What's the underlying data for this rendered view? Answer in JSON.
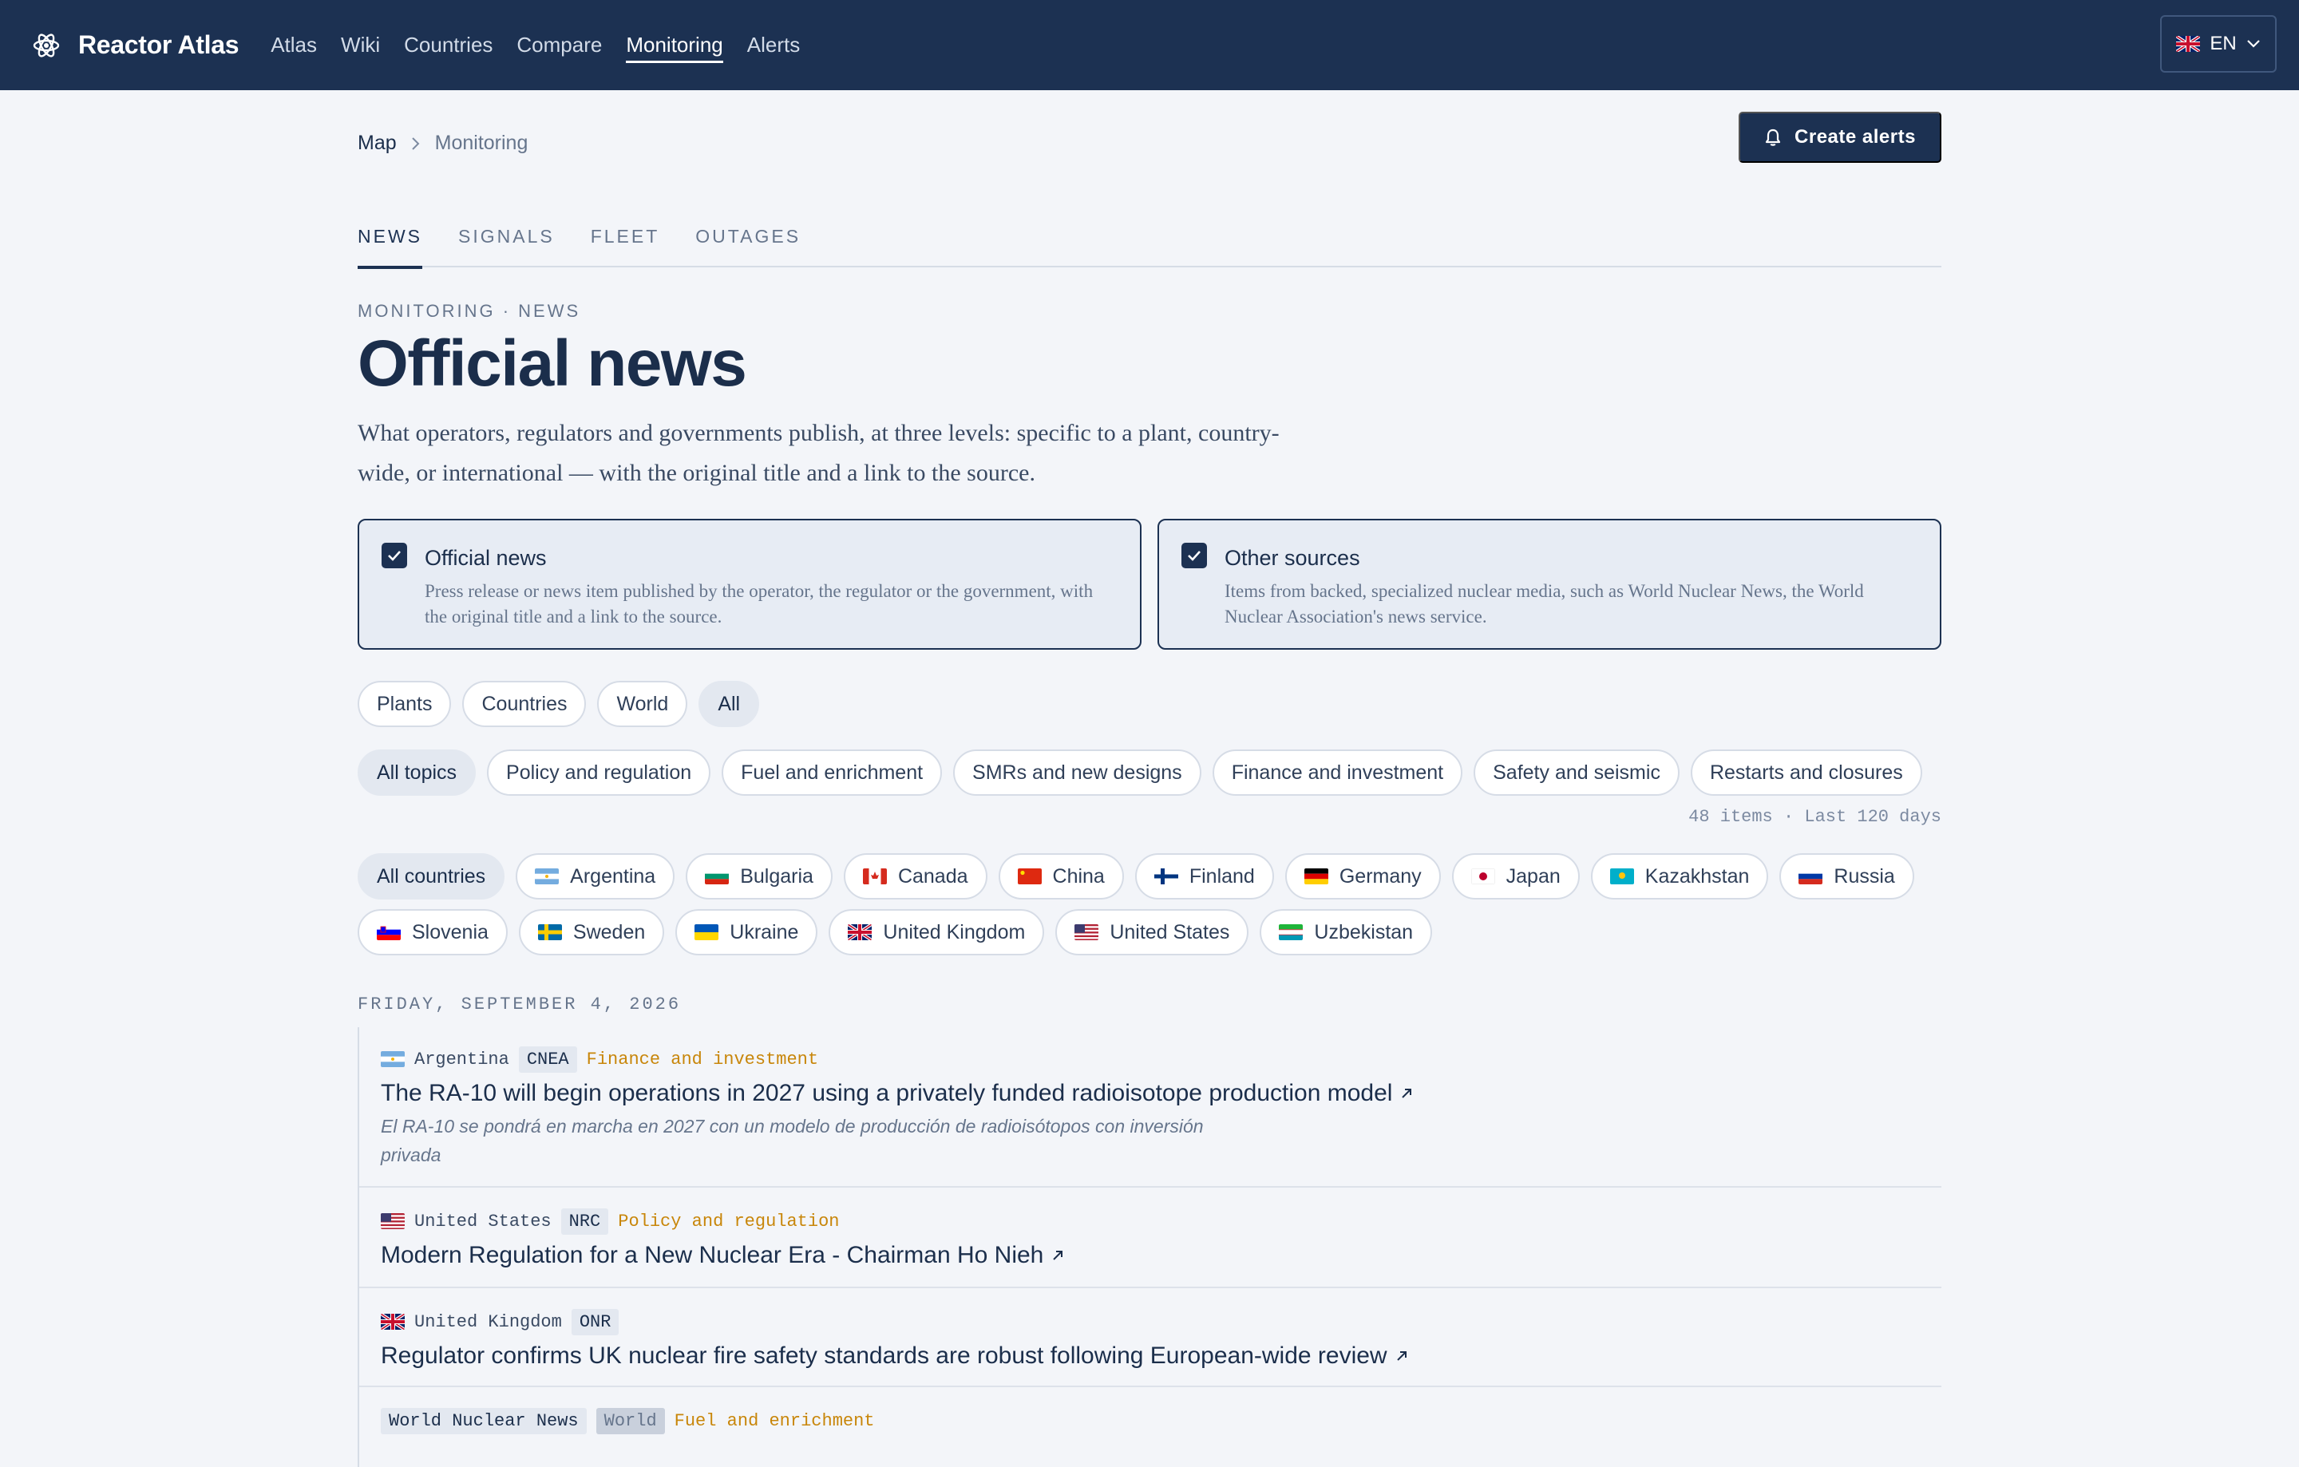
{
  "header": {
    "brand": "Reactor Atlas",
    "nav": [
      {
        "label": "Atlas",
        "active": false
      },
      {
        "label": "Wiki",
        "active": false
      },
      {
        "label": "Countries",
        "active": false
      },
      {
        "label": "Compare",
        "active": false
      },
      {
        "label": "Monitoring",
        "active": true
      },
      {
        "label": "Alerts",
        "active": false
      }
    ],
    "language": "EN",
    "language_icon": "uk-flag-icon"
  },
  "breadcrumb": {
    "root": "Map",
    "current": "Monitoring"
  },
  "create_alerts_label": "Create alerts",
  "tabs": [
    {
      "label": "NEWS",
      "active": true
    },
    {
      "label": "SIGNALS",
      "active": false
    },
    {
      "label": "FLEET",
      "active": false
    },
    {
      "label": "OUTAGES",
      "active": false
    }
  ],
  "eyebrow": "MONITORING · NEWS",
  "title": "Official news",
  "description": "What operators, regulators and governments publish, at three levels: specific to a plant, country-wide, or international — with the original title and a link to the source.",
  "sources": [
    {
      "title": "Official news",
      "checked": true,
      "description": "Press release or news item published by the operator, the regulator or the government, with the original title and a link to the source."
    },
    {
      "title": "Other sources",
      "checked": true,
      "description": "Items from backed, specialized nuclear media, such as World Nuclear News, the World Nuclear Association's news service."
    }
  ],
  "levels": [
    {
      "label": "Plants",
      "selected": false
    },
    {
      "label": "Countries",
      "selected": false
    },
    {
      "label": "World",
      "selected": false
    },
    {
      "label": "All",
      "selected": true
    }
  ],
  "topics": [
    {
      "label": "All topics",
      "selected": true
    },
    {
      "label": "Policy and regulation",
      "selected": false
    },
    {
      "label": "Fuel and enrichment",
      "selected": false
    },
    {
      "label": "SMRs and new designs",
      "selected": false
    },
    {
      "label": "Finance and investment",
      "selected": false
    },
    {
      "label": "Safety and seismic",
      "selected": false
    },
    {
      "label": "Restarts and closures",
      "selected": false
    }
  ],
  "items_meta": "48 items · Last 120 days",
  "countries": [
    {
      "label": "All countries",
      "selected": true,
      "flag": ""
    },
    {
      "label": "Argentina",
      "flag": "ar"
    },
    {
      "label": "Bulgaria",
      "flag": "bg"
    },
    {
      "label": "Canada",
      "flag": "ca"
    },
    {
      "label": "China",
      "flag": "cn"
    },
    {
      "label": "Finland",
      "flag": "fi"
    },
    {
      "label": "Germany",
      "flag": "de"
    },
    {
      "label": "Japan",
      "flag": "jp"
    },
    {
      "label": "Kazakhstan",
      "flag": "kz"
    },
    {
      "label": "Russia",
      "flag": "ru"
    },
    {
      "label": "Slovenia",
      "flag": "si"
    },
    {
      "label": "Sweden",
      "flag": "se"
    },
    {
      "label": "Ukraine",
      "flag": "ua"
    },
    {
      "label": "United Kingdom",
      "flag": "gb"
    },
    {
      "label": "United States",
      "flag": "us"
    },
    {
      "label": "Uzbekistan",
      "flag": "uz"
    }
  ],
  "date_heading": "FRIDAY, SEPTEMBER 4, 2026",
  "news": [
    {
      "country": "Argentina",
      "flag": "ar",
      "org": "CNEA",
      "topic": "Finance and investment",
      "title": "The RA-10 will begin operations in 2027 using a privately funded radioisotope production model",
      "original": "El RA-10 se pondrá en marcha en 2027 con un modelo de producción de radioisótopos con inversión privada"
    },
    {
      "country": "United States",
      "flag": "us",
      "org": "NRC",
      "topic": "Policy and regulation",
      "title": "Modern Regulation for a New Nuclear Era - Chairman Ho Nieh",
      "original": ""
    },
    {
      "country": "United Kingdom",
      "flag": "gb",
      "org": "ONR",
      "topic": "",
      "title": "Regulator confirms UK nuclear fire safety standards are robust following European-wide review",
      "original": ""
    },
    {
      "country": "",
      "flag": "",
      "source": "World Nuclear News",
      "org": "World",
      "topic": "Fuel and enrichment",
      "title": "",
      "original": ""
    }
  ],
  "colors": {
    "navy": "#1c3152",
    "background": "#f3f5f9",
    "topic_accent": "#c8860a",
    "muted": "#66758c"
  }
}
